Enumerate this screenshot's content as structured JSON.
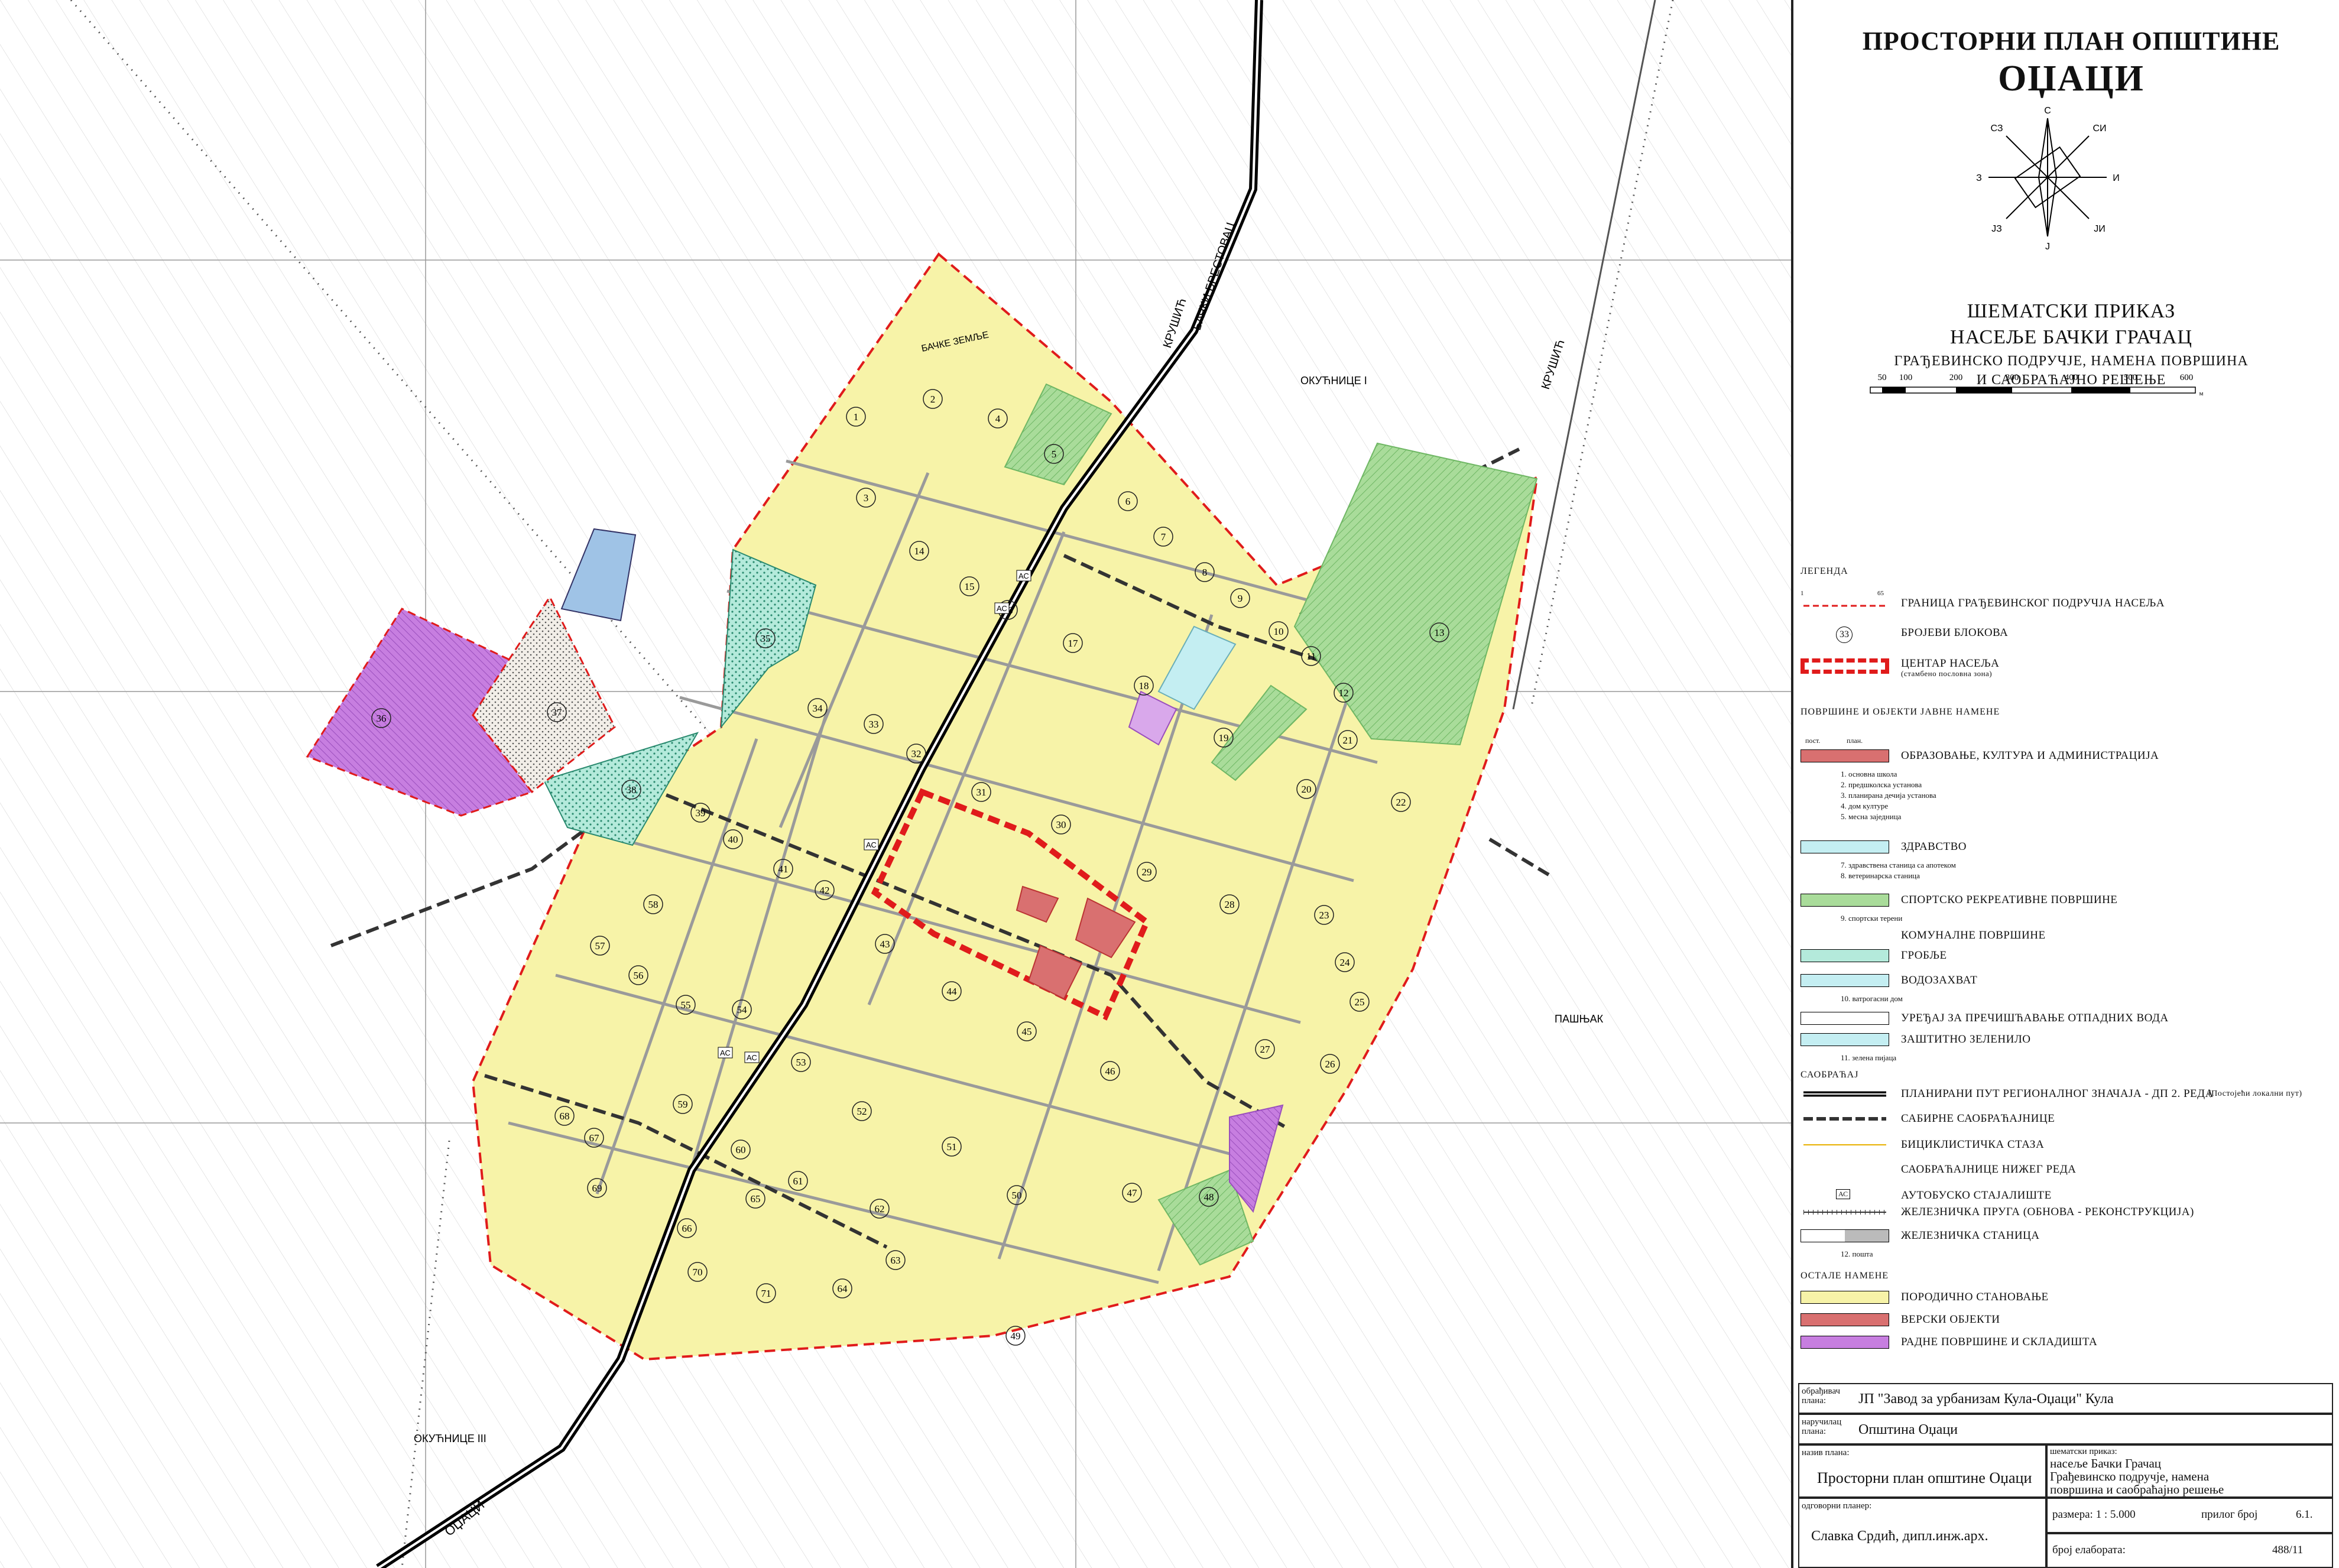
{
  "header": {
    "title_line1": "ПРОСТОРНИ ПЛАН ОПШТИНЕ",
    "title_line2": "ОЏАЦИ",
    "subtitle1": "ШЕМАТСКИ ПРИКАЗ",
    "subtitle2": "НАСЕЉЕ БАЧКИ ГРАЧАЦ",
    "subtitle3": "ГРАЂЕВИНСКО ПОДРУЧЈЕ, НАМЕНА ПОВРШИНА",
    "subtitle4": "И САОБРАЋАЈНО РЕШЕЊЕ"
  },
  "compass": {
    "n": "С",
    "s": "Ј",
    "e": "И",
    "w": "З",
    "ne": "СИ",
    "nw": "СЗ",
    "se": "ЈИ",
    "sw": "ЈЗ"
  },
  "scale_bar": {
    "labels": [
      "50",
      "100",
      "200",
      "300",
      "400",
      "500",
      "600"
    ],
    "unit": "м"
  },
  "legend": {
    "title": "ЛЕГЕНДА",
    "boundary": "ГРАНИЦА ГРАЂЕВИНСКОГ ПОДРУЧЈА НАСЕЉА",
    "boundary_numbers": [
      "1",
      "65"
    ],
    "blocks_example": "33",
    "blocks": "БРОЈЕВИ БЛОКОВА",
    "center": "ЦЕНТАР НАСЕЉА",
    "center_sub": "(стамбено пословна зона)",
    "public_title": "ПОВРШИНЕ И ОБЈЕКТИ ЈАВНЕ НАМЕНЕ",
    "col_existing": "пост.",
    "col_planned": "план.",
    "education": "ОБРАЗОВАЊЕ, КУЛТУРА И АДМИНИСТРАЦИЈА",
    "education_items": [
      "1. основна школа",
      "2. предшколска установа",
      "3. планирана дечија установа",
      "4. дом културе",
      "5. месна заједница"
    ],
    "health": "ЗДРАВСТВО",
    "health_items": [
      "7. здравствена станица са апотеком",
      "8. ветеринарска станица"
    ],
    "sport": "СПОРТСКО РЕКРЕАТИВНЕ ПОВРШИНЕ",
    "sport_items": [
      "9. спортски терени"
    ],
    "communal": "КОМУНАЛНЕ ПОВРШИНЕ",
    "cemetery": "ГРОБЉЕ",
    "water": "ВОДОЗАХВАТ",
    "water_items": [
      "10. ватрогасни дом"
    ],
    "wastewater": "УРЕЂАЈ ЗА ПРЕЧИШЋАВАЊЕ ОТПАДНИХ ВОДА",
    "greenery": "ЗАШТИТНО ЗЕЛЕНИЛО",
    "greenery_items": [
      "11. зелена пијаца"
    ],
    "traffic_title": "САОБРАЋАЈ",
    "road_regional": "ПЛАНИРАНИ ПУТ РЕГИОНАЛНОГ ЗНАЧАЈА - ДП 2. РЕДА",
    "road_regional_note": "(Постојећи локални пут)",
    "collector": "САБИРНЕ САОБРАЋАЈНИЦЕ",
    "bike": "БИЦИКЛИСТИЧКА СТАЗА",
    "lower": "САОБРАЋАЈНИЦЕ НИЖЕГ РЕДА",
    "bus_symbol": "АС",
    "bus": "АУТОБУСКО СТАЈАЛИШТЕ",
    "railway": "ЖЕЛЕЗНИЧКА ПРУГА (ОБНОВА - РЕКОНСТРУКЦИЈА)",
    "station": "ЖЕЛЕЗНИЧКА СТАНИЦА",
    "station_items": [
      "12. пошта"
    ],
    "other_title": "ОСТАЛЕ НАМЕНЕ",
    "housing": "ПОРОДИЧНО СТАНОВАЊЕ",
    "religious": "ВЕРСКИ ОБЈЕКТИ",
    "work": "РАДНЕ ПОВРШИНЕ И СКЛАДИШТА"
  },
  "title_block": {
    "maker_label": "обрађивач плана:",
    "maker": "ЈП \"Завод за урбанизам Кула-Оџаци\" Кула",
    "client_label": "наручилац плана:",
    "client": "Општина Оџаци",
    "plan_name_label": "назив плана:",
    "plan_name": "Просторни план општине Оџаци",
    "content_label": "шематски приказ:",
    "content": [
      "насеље Бачки Грачац",
      "Грађевинско подручје, намена",
      "површина и саобраћајно решење"
    ],
    "planner_label": "одговорни планер:",
    "planner": "Славка Срдић, дипл.инж.арх.",
    "scale_label": "размера: 1 : 5.000",
    "sheet_label": "прилог број",
    "sheet": "6.1.",
    "number_label": "број елабората:",
    "number": "488/11"
  },
  "map_labels": {
    "road_north": "БАЧКИ БРЕСТОВАЦ",
    "road_krusic": "КРУШИЋ",
    "road_krusic2": "КРУШИЋ",
    "road_south": "ОЏАЦИ",
    "okucnice1": "ОКУЋНИЦЕ I",
    "okucnice3": "ОКУЋНИЦЕ III",
    "pasnjak": "ПАШЊАК",
    "zemlje": "БАЧКЕ ЗЕМЉЕ",
    "stop_label": "АС"
  },
  "colors": {
    "housing": "#f7f3a8",
    "center_boundary": "#e01b1b",
    "sport": "#a9dc9a",
    "cemetery": "#b4eadb",
    "health": "#c4eef2",
    "work": "#c77ee0",
    "education": "#d97070",
    "wastewater": "#9fc3e6"
  }
}
